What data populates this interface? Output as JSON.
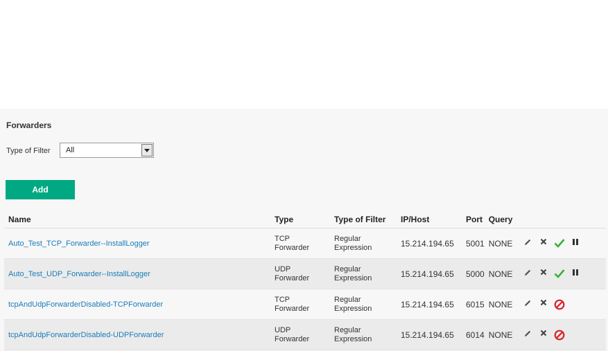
{
  "page": {
    "title": "Forwarders"
  },
  "filter": {
    "label": "Type of Filter",
    "selected": "All"
  },
  "actions": {
    "add_label": "Add"
  },
  "table": {
    "headers": {
      "name": "Name",
      "type": "Type",
      "type_of_filter": "Type of Filter",
      "ip_host": "IP/Host",
      "port": "Port",
      "query": "Query"
    },
    "rows": [
      {
        "name": "Auto_Test_TCP_Forwarder--InstallLogger",
        "type_line1": "TCP",
        "type_line2": "Forwarder",
        "filter_line1": "Regular",
        "filter_line2": "Expression",
        "ip": "15.214.194.65",
        "port": "5001",
        "query": "NONE",
        "enabled": true
      },
      {
        "name": "Auto_Test_UDP_Forwarder--InstallLogger",
        "type_line1": "UDP",
        "type_line2": "Forwarder",
        "filter_line1": "Regular",
        "filter_line2": "Expression",
        "ip": "15.214.194.65",
        "port": "5000",
        "query": "NONE",
        "enabled": true
      },
      {
        "name": "tcpAndUdpForwarderDisabled-TCPForwarder",
        "type_line1": "TCP",
        "type_line2": "Forwarder",
        "filter_line1": "Regular",
        "filter_line2": "Expression",
        "ip": "15.214.194.65",
        "port": "6015",
        "query": "NONE",
        "enabled": false
      },
      {
        "name": "tcpAndUdpForwarderDisabled-UDPForwarder",
        "type_line1": "UDP",
        "type_line2": "Forwarder",
        "filter_line1": "Regular",
        "filter_line2": "Expression",
        "ip": "15.214.194.65",
        "port": "6014",
        "query": "NONE",
        "enabled": false
      }
    ]
  },
  "icons": {
    "edit": "pencil-icon",
    "delete": "x-icon",
    "enabled": "check-icon",
    "pause": "pause-icon",
    "disabled": "disabled-icon"
  },
  "colors": {
    "accent": "#01a982",
    "link": "#1a7bb9",
    "check": "#34b233",
    "disabled": "#d9232d"
  }
}
